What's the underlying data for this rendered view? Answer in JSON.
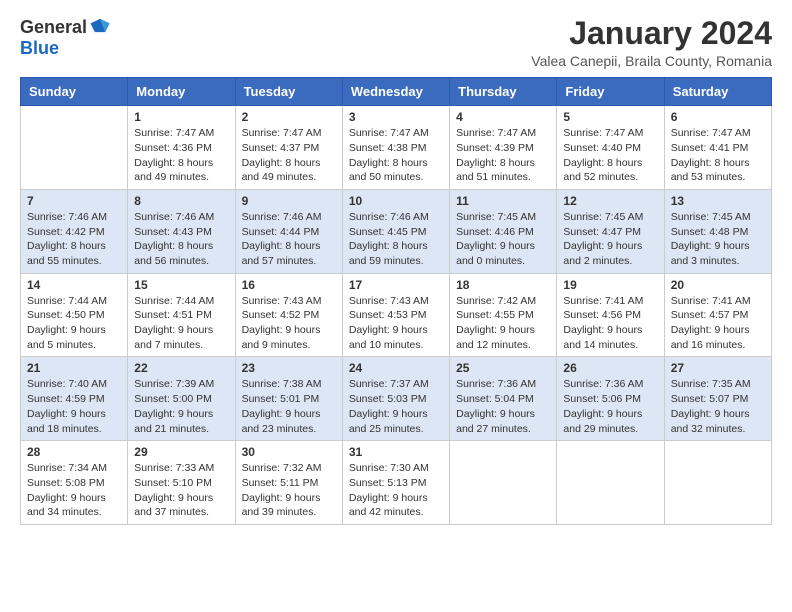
{
  "logo": {
    "general": "General",
    "blue": "Blue"
  },
  "title": "January 2024",
  "subtitle": "Valea Canepii, Braila County, Romania",
  "days_of_week": [
    "Sunday",
    "Monday",
    "Tuesday",
    "Wednesday",
    "Thursday",
    "Friday",
    "Saturday"
  ],
  "weeks": [
    [
      {
        "day": "",
        "content": ""
      },
      {
        "day": "1",
        "content": "Sunrise: 7:47 AM\nSunset: 4:36 PM\nDaylight: 8 hours\nand 49 minutes."
      },
      {
        "day": "2",
        "content": "Sunrise: 7:47 AM\nSunset: 4:37 PM\nDaylight: 8 hours\nand 49 minutes."
      },
      {
        "day": "3",
        "content": "Sunrise: 7:47 AM\nSunset: 4:38 PM\nDaylight: 8 hours\nand 50 minutes."
      },
      {
        "day": "4",
        "content": "Sunrise: 7:47 AM\nSunset: 4:39 PM\nDaylight: 8 hours\nand 51 minutes."
      },
      {
        "day": "5",
        "content": "Sunrise: 7:47 AM\nSunset: 4:40 PM\nDaylight: 8 hours\nand 52 minutes."
      },
      {
        "day": "6",
        "content": "Sunrise: 7:47 AM\nSunset: 4:41 PM\nDaylight: 8 hours\nand 53 minutes."
      }
    ],
    [
      {
        "day": "7",
        "content": "Sunrise: 7:46 AM\nSunset: 4:42 PM\nDaylight: 8 hours\nand 55 minutes."
      },
      {
        "day": "8",
        "content": "Sunrise: 7:46 AM\nSunset: 4:43 PM\nDaylight: 8 hours\nand 56 minutes."
      },
      {
        "day": "9",
        "content": "Sunrise: 7:46 AM\nSunset: 4:44 PM\nDaylight: 8 hours\nand 57 minutes."
      },
      {
        "day": "10",
        "content": "Sunrise: 7:46 AM\nSunset: 4:45 PM\nDaylight: 8 hours\nand 59 minutes."
      },
      {
        "day": "11",
        "content": "Sunrise: 7:45 AM\nSunset: 4:46 PM\nDaylight: 9 hours\nand 0 minutes."
      },
      {
        "day": "12",
        "content": "Sunrise: 7:45 AM\nSunset: 4:47 PM\nDaylight: 9 hours\nand 2 minutes."
      },
      {
        "day": "13",
        "content": "Sunrise: 7:45 AM\nSunset: 4:48 PM\nDaylight: 9 hours\nand 3 minutes."
      }
    ],
    [
      {
        "day": "14",
        "content": "Sunrise: 7:44 AM\nSunset: 4:50 PM\nDaylight: 9 hours\nand 5 minutes."
      },
      {
        "day": "15",
        "content": "Sunrise: 7:44 AM\nSunset: 4:51 PM\nDaylight: 9 hours\nand 7 minutes."
      },
      {
        "day": "16",
        "content": "Sunrise: 7:43 AM\nSunset: 4:52 PM\nDaylight: 9 hours\nand 9 minutes."
      },
      {
        "day": "17",
        "content": "Sunrise: 7:43 AM\nSunset: 4:53 PM\nDaylight: 9 hours\nand 10 minutes."
      },
      {
        "day": "18",
        "content": "Sunrise: 7:42 AM\nSunset: 4:55 PM\nDaylight: 9 hours\nand 12 minutes."
      },
      {
        "day": "19",
        "content": "Sunrise: 7:41 AM\nSunset: 4:56 PM\nDaylight: 9 hours\nand 14 minutes."
      },
      {
        "day": "20",
        "content": "Sunrise: 7:41 AM\nSunset: 4:57 PM\nDaylight: 9 hours\nand 16 minutes."
      }
    ],
    [
      {
        "day": "21",
        "content": "Sunrise: 7:40 AM\nSunset: 4:59 PM\nDaylight: 9 hours\nand 18 minutes."
      },
      {
        "day": "22",
        "content": "Sunrise: 7:39 AM\nSunset: 5:00 PM\nDaylight: 9 hours\nand 21 minutes."
      },
      {
        "day": "23",
        "content": "Sunrise: 7:38 AM\nSunset: 5:01 PM\nDaylight: 9 hours\nand 23 minutes."
      },
      {
        "day": "24",
        "content": "Sunrise: 7:37 AM\nSunset: 5:03 PM\nDaylight: 9 hours\nand 25 minutes."
      },
      {
        "day": "25",
        "content": "Sunrise: 7:36 AM\nSunset: 5:04 PM\nDaylight: 9 hours\nand 27 minutes."
      },
      {
        "day": "26",
        "content": "Sunrise: 7:36 AM\nSunset: 5:06 PM\nDaylight: 9 hours\nand 29 minutes."
      },
      {
        "day": "27",
        "content": "Sunrise: 7:35 AM\nSunset: 5:07 PM\nDaylight: 9 hours\nand 32 minutes."
      }
    ],
    [
      {
        "day": "28",
        "content": "Sunrise: 7:34 AM\nSunset: 5:08 PM\nDaylight: 9 hours\nand 34 minutes."
      },
      {
        "day": "29",
        "content": "Sunrise: 7:33 AM\nSunset: 5:10 PM\nDaylight: 9 hours\nand 37 minutes."
      },
      {
        "day": "30",
        "content": "Sunrise: 7:32 AM\nSunset: 5:11 PM\nDaylight: 9 hours\nand 39 minutes."
      },
      {
        "day": "31",
        "content": "Sunrise: 7:30 AM\nSunset: 5:13 PM\nDaylight: 9 hours\nand 42 minutes."
      },
      {
        "day": "",
        "content": ""
      },
      {
        "day": "",
        "content": ""
      },
      {
        "day": "",
        "content": ""
      }
    ]
  ]
}
